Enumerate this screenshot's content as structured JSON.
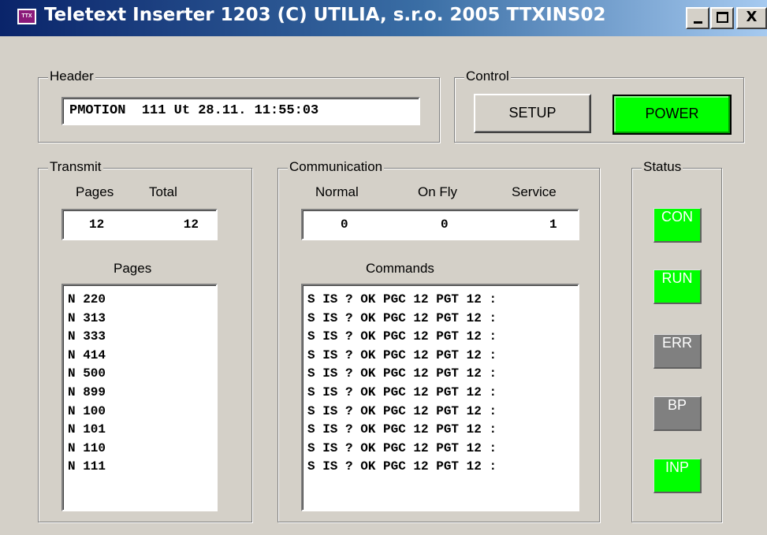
{
  "window": {
    "title": "Teletext Inserter 1203 (C) UTILIA, s.r.o. 2005 TTXINS02",
    "icon": "ttx-app-icon",
    "icon_text": "TTX",
    "minimize_icon": "minimize-icon",
    "maximize_icon": "maximize-icon",
    "close_icon": "close-icon",
    "close_glyph": "X"
  },
  "header": {
    "group_label": "Header",
    "value": "PMOTION  111 Ut 28.11. 11:55:03"
  },
  "control": {
    "group_label": "Control",
    "setup_label": "SETUP",
    "power_label": "POWER",
    "power_color": "#00ff00"
  },
  "transmit": {
    "group_label": "Transmit",
    "pages_header": "Pages",
    "total_header": "Total",
    "pages_value": "12",
    "total_value": "12",
    "pages_list_label": "Pages",
    "pages_list": [
      "N 220",
      "N 313",
      "N 333",
      "N 414",
      "N 500",
      "N 899",
      "N 100",
      "N 101",
      "N 110",
      "N 111"
    ]
  },
  "communication": {
    "group_label": "Communication",
    "normal_header": "Normal",
    "onfly_header": "On Fly",
    "service_header": "Service",
    "normal_value": "0",
    "onfly_value": "0",
    "service_value": "1",
    "commands_label": "Commands",
    "commands": [
      "S IS ? OK PGC 12 PGT 12 :",
      "S IS ? OK PGC 12 PGT 12 :",
      "S IS ? OK PGC 12 PGT 12 :",
      "S IS ? OK PGC 12 PGT 12 :",
      "S IS ? OK PGC 12 PGT 12 :",
      "S IS ? OK PGC 12 PGT 12 :",
      "S IS ? OK PGC 12 PGT 12 :",
      "S IS ? OK PGC 12 PGT 12 :",
      "S IS ? OK PGC 12 PGT 12 :",
      "S IS ? OK PGC 12 PGT 12 :"
    ]
  },
  "status": {
    "group_label": "Status",
    "con_label": "CON",
    "run_label": "RUN",
    "err_label": "ERR",
    "bp_label": "BP",
    "inp_label": "INP",
    "on_color": "#00ff00",
    "off_color": "#808080"
  }
}
